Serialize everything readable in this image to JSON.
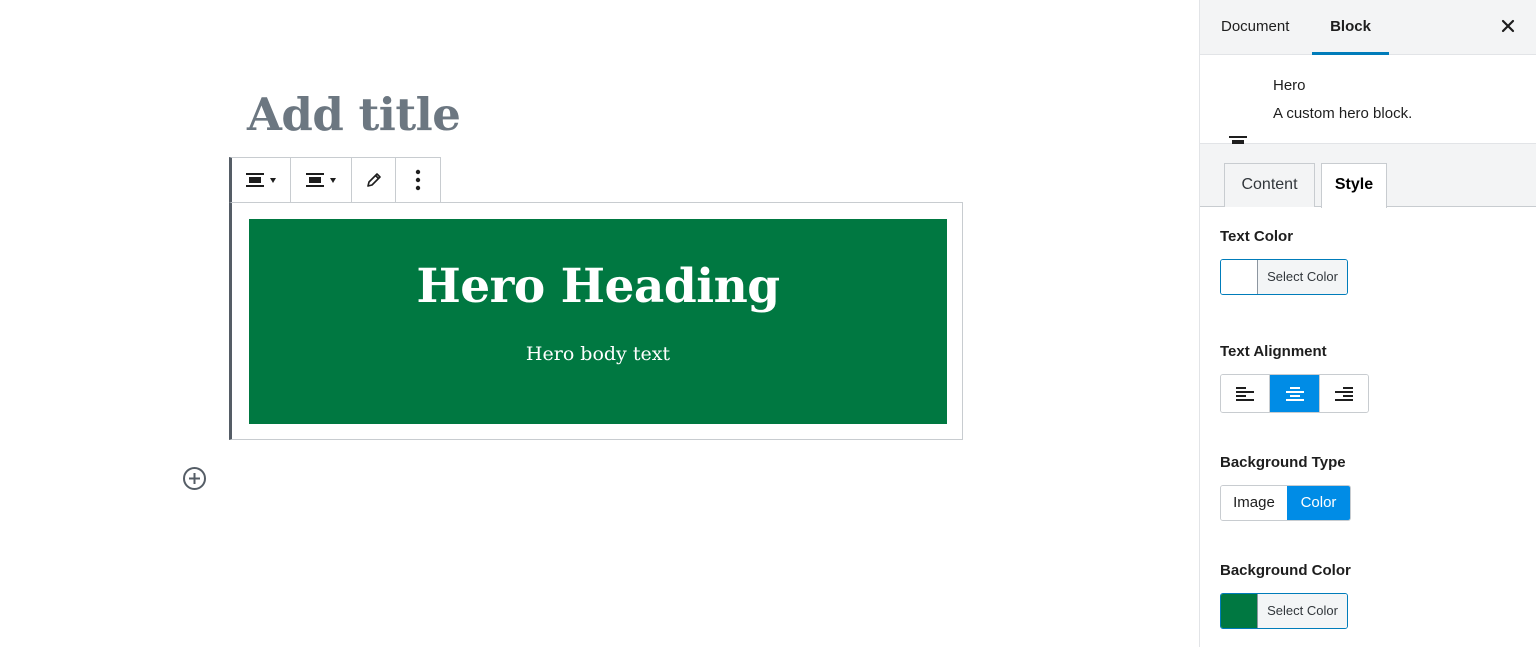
{
  "editor": {
    "title_placeholder": "Add title",
    "toolbar": {
      "buttons": [
        "align-center-icon",
        "align-center-icon",
        "pencil-icon",
        "more-vertical-icon"
      ]
    },
    "hero": {
      "heading": "Hero Heading",
      "body": "Hero body text",
      "background_color": "#007841",
      "text_color": "#ffffff"
    }
  },
  "sidebar": {
    "tabs": {
      "document": "Document",
      "block": "Block"
    },
    "block_card": {
      "name": "Hero",
      "description": "A custom hero block."
    },
    "inner_tabs": {
      "content": "Content",
      "style": "Style",
      "active": "Style"
    },
    "text_color": {
      "label": "Text Color",
      "button": "Select Color",
      "value": "#ffffff"
    },
    "text_alignment": {
      "label": "Text Alignment",
      "options": [
        "left",
        "center",
        "right"
      ],
      "selected": "center"
    },
    "background_type": {
      "label": "Background Type",
      "options": [
        "Image",
        "Color"
      ],
      "selected": "Color"
    },
    "background_color": {
      "label": "Background Color",
      "button": "Select Color",
      "value": "#007841"
    }
  },
  "colors": {
    "accent": "#008ce6",
    "tab_underline": "#007cba",
    "hero_green": "#007841"
  }
}
